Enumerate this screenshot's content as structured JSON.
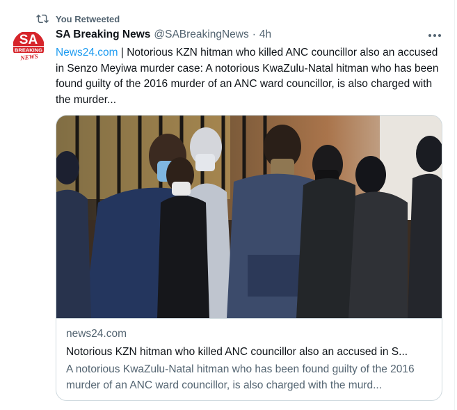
{
  "retweet": {
    "label": "You Retweeted",
    "icon": "retweet-icon"
  },
  "author": {
    "name": "SA Breaking News",
    "handle": "@SABreakingNews",
    "separator": "·",
    "time": "4h",
    "avatar": {
      "line1": "SA",
      "line2": "BREAKING",
      "line3": "NEWS"
    }
  },
  "more_icon": "more-icon",
  "tweet": {
    "link_text": "News24.com",
    "body": " | Notorious KZN hitman who killed ANC councillor also an accused in Senzo Meyiwa murder case: A notorious KwaZulu-Natal hitman who has been found guilty of the 2016 murder of an ANC ward councillor, is also charged with the murder..."
  },
  "card": {
    "domain": "news24.com",
    "title": "Notorious KZN hitman who killed ANC councillor also an accused in S...",
    "description": "A notorious KwaZulu-Natal hitman who has been found guilty of the 2016 murder of an ANC ward councillor, is also charged with the murd..."
  },
  "colors": {
    "accent": "#1d9bf0",
    "secondary_text": "#536471",
    "brand_red": "#d6252b"
  }
}
